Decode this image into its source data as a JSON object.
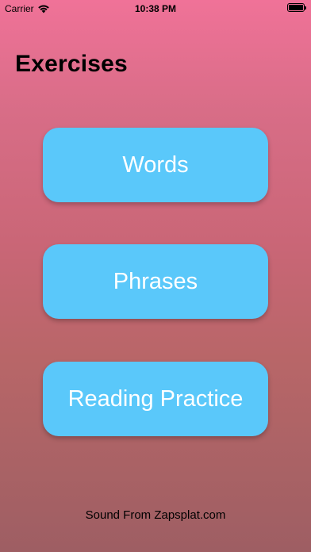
{
  "status_bar": {
    "carrier": "Carrier",
    "time": "10:38 PM",
    "icons": [
      "wifi-icon",
      "battery-icon"
    ]
  },
  "page": {
    "title": "Exercises"
  },
  "buttons": [
    {
      "label": "Words"
    },
    {
      "label": "Phrases"
    },
    {
      "label": "Reading Practice"
    }
  ],
  "footer": {
    "credit": "Sound From Zapsplat.com"
  },
  "colors": {
    "button_background": "#5ac8fa",
    "button_text": "#ffffff",
    "background_top": "#f07298",
    "background_bottom": "#9e5e63"
  }
}
